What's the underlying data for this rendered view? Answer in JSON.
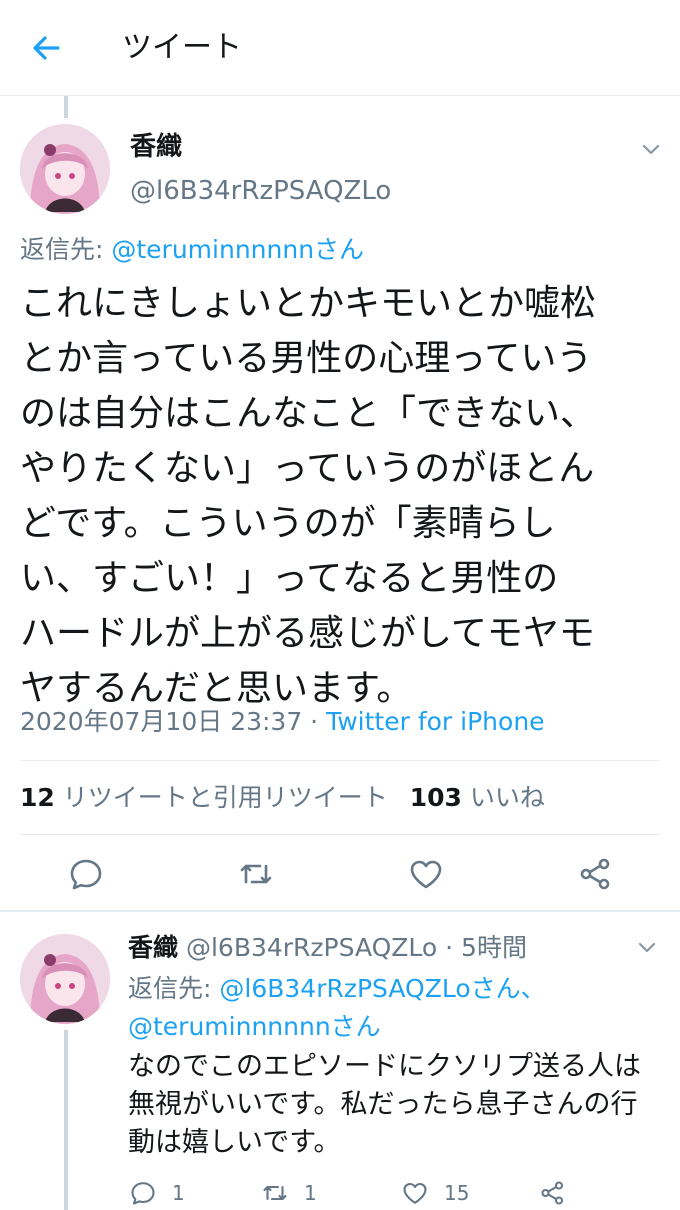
{
  "header": {
    "title": "ツイート"
  },
  "main_tweet": {
    "name": "香織",
    "handle": "@l6B34rRzPSAQZLo",
    "reply_prefix": "返信先: ",
    "reply_to": "@teruminnnnnnさん",
    "text": "これにきしょいとかキモいとか嘘松\nとか言っている男性の心理っていう\nのは自分はこんなこと「できない、\nやりたくない」っていうのがほとん\nどです。こういうのが「素晴らし\nい、すごい！」ってなると男性の\nハードルが上がる感じがしてモヤモ\nヤするんだと思います。",
    "timestamp": "2020年07月10日 23:37 · ",
    "source": "Twitter for iPhone",
    "retweet_count": "12",
    "retweet_label": " リツイートと引用リツイート",
    "like_count": "103",
    "like_label": " いいね"
  },
  "reply_tweet": {
    "name": "香織",
    "handle_time": " @l6B34rRzPSAQZLo · 5時間",
    "reply_prefix": "返信先: ",
    "reply_to_1": "@l6B34rRzPSAQZLoさん、",
    "reply_to_2": "@teruminnnnnnさん",
    "text": "なのでこのエピソードにクソリプ送る人は\n無視がいいです。私だったら息子さんの行\n動は嬉しいです。",
    "reply_count": "1",
    "retweet_count": "1",
    "like_count": "15"
  },
  "colors": {
    "accent": "#1da1f2",
    "muted": "#657786",
    "text": "#14171a",
    "border": "#e6ecf0"
  }
}
